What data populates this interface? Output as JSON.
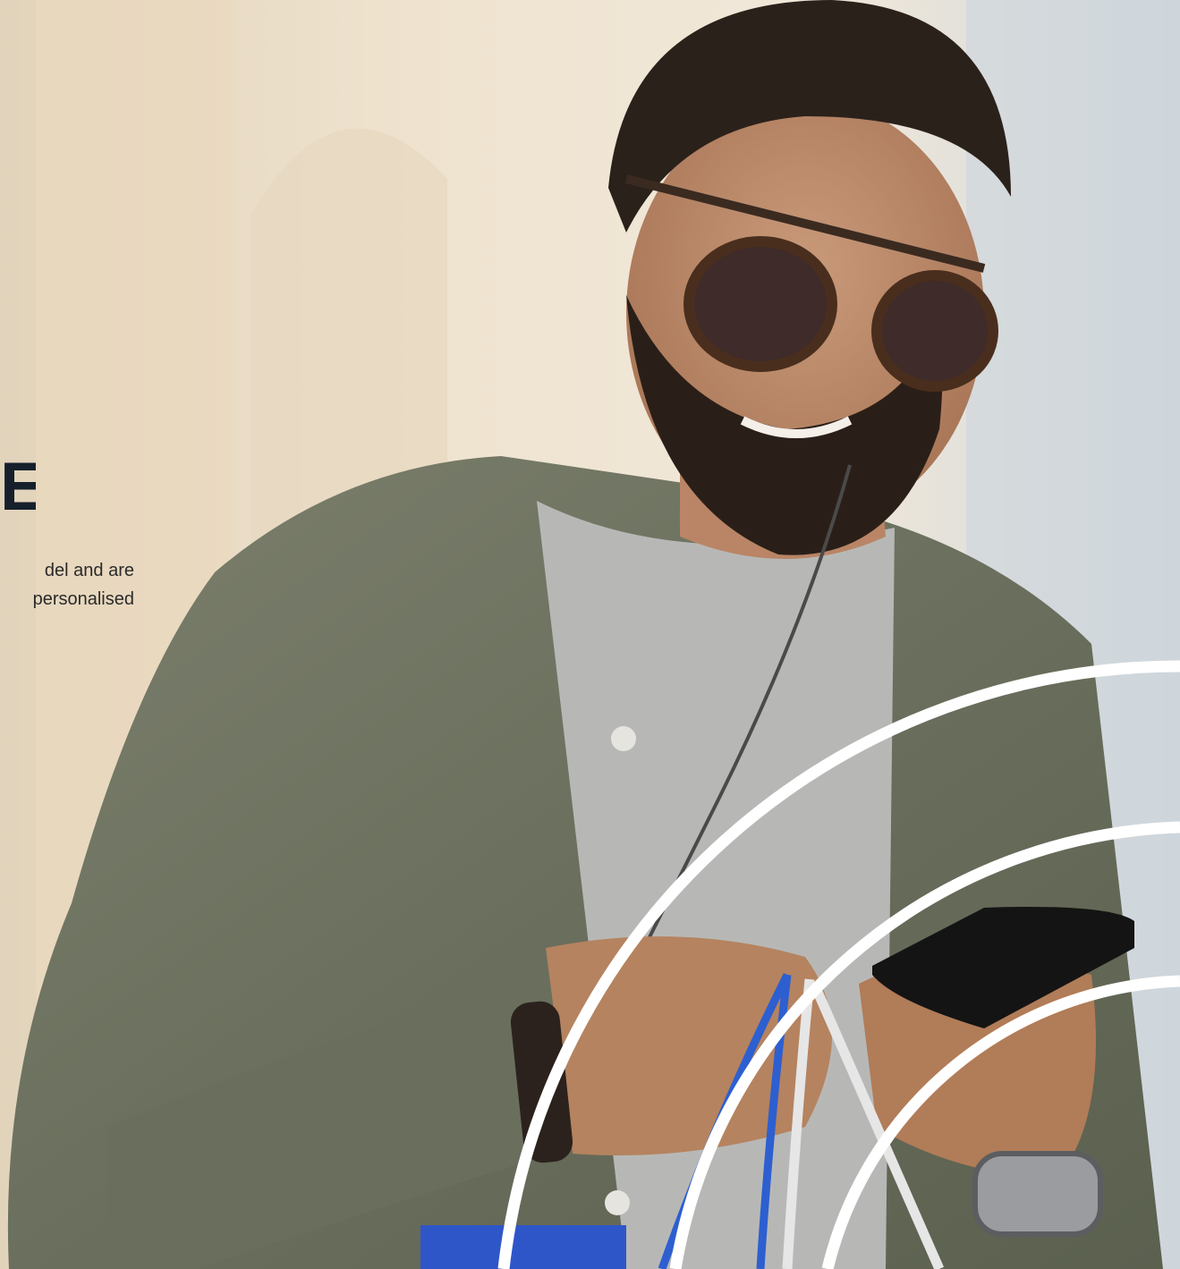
{
  "heading": {
    "visible_fragment": "E."
  },
  "body_text": {
    "line_1": "del and are",
    "line_2": "personalised"
  },
  "colors": {
    "heading_text": "#16202c",
    "body_text": "#2a2a2a",
    "arc_stroke": "#ffffff",
    "shirt": "#6f7462",
    "tshirt": "#b7b8b6",
    "background": "#e9ddc9"
  },
  "photo": {
    "subject": "bearded man in sunglasses smiling at phone while holding shopping bags",
    "objects": [
      "sunglasses",
      "smartphone",
      "shopping-bags",
      "wristwatch",
      "leather-bracelet",
      "earphone-cable"
    ]
  }
}
